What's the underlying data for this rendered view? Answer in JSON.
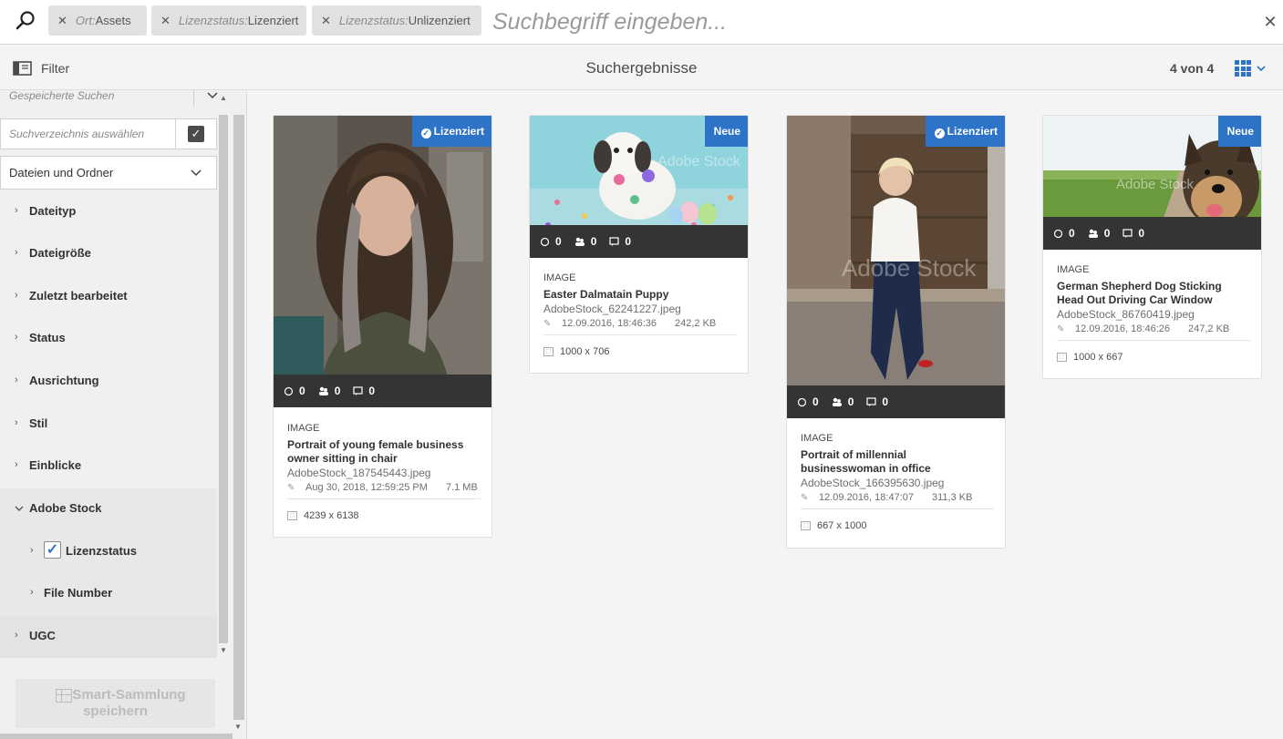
{
  "search": {
    "placeholder": "Suchbegriff eingeben...",
    "chips": [
      {
        "key": "Ort:",
        "value": " Assets"
      },
      {
        "key": "Lizenzstatus:",
        "value": "Lizenziert"
      },
      {
        "key": "Lizenzstatus:",
        "value": "Unlizenziert"
      }
    ],
    "chip_remove": "✕",
    "close": "✕"
  },
  "actionbar": {
    "filter_label": "Filter",
    "title": "Suchergebnisse",
    "count": "4 von 4"
  },
  "panel": {
    "saved_searches": "Gespeicherte Suchen",
    "directory_placeholder": "Suchverzeichnis auswählen",
    "files_dropdown": "Dateien und Ordner",
    "facets": [
      "Dateityp",
      "Dateigröße",
      "Zuletzt bearbeitet",
      "Status",
      "Ausrichtung",
      "Stil",
      "Einblicke",
      "Adobe Stock"
    ],
    "subfacets": [
      "Lizenzstatus",
      "File Number"
    ],
    "ugc": "UGC",
    "smart_collection_line1": "Smart-Sammlung",
    "smart_collection_line2": "speichern"
  },
  "cards": [
    {
      "badge": "Lizenziert",
      "stats": [
        "0",
        "0",
        "0"
      ],
      "type": "IMAGE",
      "title": "Portrait of young female business owner sitting in chair",
      "file": "AdobeStock_187545443.jpeg",
      "modified": "Aug 30, 2018, 12:59:25 PM",
      "size": "7.1 MB",
      "dims": "4239 x 6138"
    },
    {
      "badge": "Neue",
      "stats": [
        "0",
        "0",
        "0"
      ],
      "type": "IMAGE",
      "title": "Easter Dalmatain Puppy",
      "file": "AdobeStock_62241227.jpeg",
      "modified": "12.09.2016, 18:46:36",
      "size": "242,2 KB",
      "dims": "1000 x 706"
    },
    {
      "badge": "Lizenziert",
      "stats": [
        "0",
        "0",
        "0"
      ],
      "type": "IMAGE",
      "title": "Portrait of millennial businesswoman in office",
      "file": "AdobeStock_166395630.jpeg",
      "modified": "12.09.2016, 18:47:07",
      "size": "311,3 KB",
      "dims": "667 x 1000"
    },
    {
      "badge": "Neue",
      "stats": [
        "0",
        "0",
        "0"
      ],
      "type": "IMAGE",
      "title": "German Shepherd Dog Sticking Head Out Driving Car Window",
      "file": "AdobeStock_86760419.jpeg",
      "modified": "12.09.2016, 18:46:26",
      "size": "247,2 KB",
      "dims": "1000 x 667"
    }
  ],
  "watermark": "Adobe Stock",
  "colors": {
    "accent": "#2d73c7",
    "stats_bar": "#343434"
  },
  "icons": [
    "search-icon",
    "close-icon",
    "rail-toggle-icon",
    "grid-view-icon",
    "chevron-down-icon",
    "chevron-right-icon",
    "checkmark-icon",
    "sync-icon",
    "users-icon",
    "comment-icon",
    "pencil-icon",
    "dimensions-icon",
    "table-icon"
  ]
}
